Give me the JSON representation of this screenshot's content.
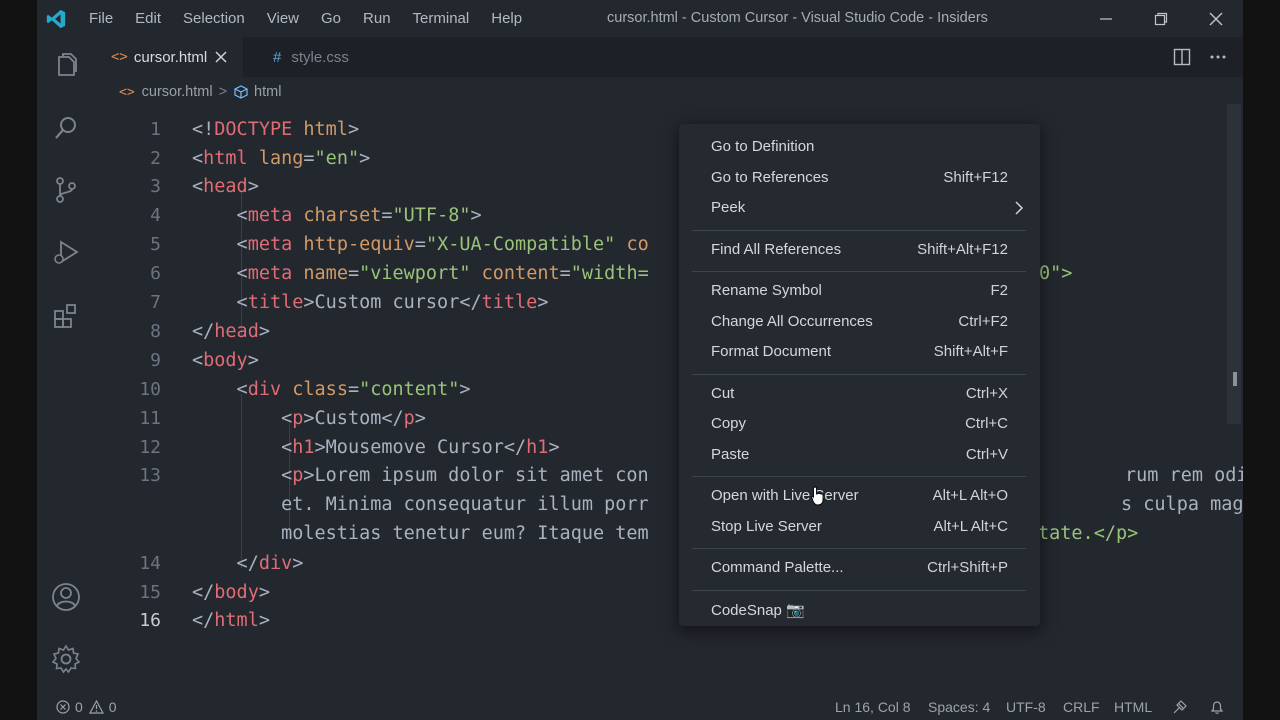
{
  "titlebar": {
    "menu": [
      "File",
      "Edit",
      "Selection",
      "View",
      "Go",
      "Run",
      "Terminal",
      "Help"
    ],
    "title": "cursor.html - Custom Cursor - Visual Studio Code - Insiders"
  },
  "tabs": [
    {
      "icon": "<>",
      "label": "cursor.html"
    },
    {
      "icon": "#",
      "label": "style.css"
    }
  ],
  "breadcrumb": {
    "file": "cursor.html",
    "separator": ">",
    "symbol": "html"
  },
  "editor": {
    "line_numbers": [
      "1",
      "2",
      "3",
      "4",
      "5",
      "6",
      "7",
      "8",
      "9",
      "10",
      "11",
      "12",
      "13",
      "14",
      "15",
      "16"
    ],
    "lines": [
      [
        [
          "x",
          "<!"
        ],
        [
          "t",
          "DOCTYPE"
        ],
        [
          "x",
          " "
        ],
        [
          "a",
          "html"
        ],
        [
          "x",
          ">"
        ]
      ],
      [
        [
          "x",
          "<"
        ],
        [
          "t",
          "html"
        ],
        [
          "x",
          " "
        ],
        [
          "a",
          "lang"
        ],
        [
          "x",
          "="
        ],
        [
          "s",
          "\"en\""
        ],
        [
          "x",
          ">"
        ]
      ],
      [
        [
          "x",
          "<"
        ],
        [
          "t",
          "head"
        ],
        [
          "x",
          ">"
        ]
      ],
      [
        [
          "x",
          "    <"
        ],
        [
          "t",
          "meta"
        ],
        [
          "x",
          " "
        ],
        [
          "a",
          "charset"
        ],
        [
          "x",
          "="
        ],
        [
          "s",
          "\"UTF-8\""
        ],
        [
          "x",
          ">"
        ]
      ],
      [
        [
          "x",
          "    <"
        ],
        [
          "t",
          "meta"
        ],
        [
          "x",
          " "
        ],
        [
          "a",
          "http-equiv"
        ],
        [
          "x",
          "="
        ],
        [
          "s",
          "\"X-UA-Compatible\""
        ],
        [
          "x",
          " "
        ],
        [
          "a",
          "co"
        ]
      ],
      [
        [
          "x",
          "    <"
        ],
        [
          "t",
          "meta"
        ],
        [
          "x",
          " "
        ],
        [
          "a",
          "name"
        ],
        [
          "x",
          "="
        ],
        [
          "s",
          "\"viewport\""
        ],
        [
          "x",
          " "
        ],
        [
          "a",
          "content"
        ],
        [
          "x",
          "="
        ],
        [
          "s",
          "\"width="
        ]
      ],
      [
        [
          "x",
          "    <"
        ],
        [
          "t",
          "title"
        ],
        [
          "x",
          ">Custom cursor</"
        ],
        [
          "t",
          "title"
        ],
        [
          "x",
          ">"
        ]
      ],
      [
        [
          "x",
          "</"
        ],
        [
          "t",
          "head"
        ],
        [
          "x",
          ">"
        ]
      ],
      [
        [
          "x",
          "<"
        ],
        [
          "t",
          "body"
        ],
        [
          "x",
          ">"
        ]
      ],
      [
        [
          "x",
          "    <"
        ],
        [
          "t",
          "div"
        ],
        [
          "x",
          " "
        ],
        [
          "a",
          "class"
        ],
        [
          "x",
          "="
        ],
        [
          "s",
          "\"content\""
        ],
        [
          "x",
          ">"
        ]
      ],
      [
        [
          "x",
          "        <"
        ],
        [
          "t",
          "p"
        ],
        [
          "x",
          ">Custom</"
        ],
        [
          "t",
          "p"
        ],
        [
          "x",
          ">"
        ]
      ],
      [
        [
          "x",
          "        <"
        ],
        [
          "t",
          "h1"
        ],
        [
          "x",
          ">Mousemove Cursor</"
        ],
        [
          "t",
          "h1"
        ],
        [
          "x",
          ">"
        ]
      ],
      [
        [
          "x",
          "        <"
        ],
        [
          "t",
          "p"
        ],
        [
          "x",
          ">Lorem ipsum dolor sit amet con"
        ]
      ],
      [
        [
          "x",
          "        et. Minima consequatur illum porr"
        ]
      ],
      [
        [
          "x",
          "        molestias tenetur eum? Itaque tem"
        ]
      ],
      [
        [
          "x",
          "    </"
        ],
        [
          "t",
          "div"
        ],
        [
          "x",
          ">"
        ]
      ],
      [
        [
          "x",
          "</"
        ],
        [
          "t",
          "body"
        ],
        [
          "x",
          ">"
        ]
      ],
      [
        [
          "x",
          "</"
        ],
        [
          "t",
          "html"
        ],
        [
          "x",
          ">"
        ]
      ]
    ],
    "right_overflow": [
      {
        "text": "0\">",
        "row": 5
      },
      {
        "text": "rum rem odio",
        "row": 12
      },
      {
        "text": "s culpa magni",
        "row": 13
      },
      {
        "text": "tate.</p>",
        "row": 14
      }
    ]
  },
  "context_menu": {
    "groups": [
      [
        {
          "label": "Go to Definition",
          "shortcut": ""
        },
        {
          "label": "Go to References",
          "shortcut": "Shift+F12"
        },
        {
          "label": "Peek",
          "shortcut": "",
          "submenu": true
        }
      ],
      [
        {
          "label": "Find All References",
          "shortcut": "Shift+Alt+F12"
        }
      ],
      [
        {
          "label": "Rename Symbol",
          "shortcut": "F2"
        },
        {
          "label": "Change All Occurrences",
          "shortcut": "Ctrl+F2"
        },
        {
          "label": "Format Document",
          "shortcut": "Shift+Alt+F"
        }
      ],
      [
        {
          "label": "Cut",
          "shortcut": "Ctrl+X"
        },
        {
          "label": "Copy",
          "shortcut": "Ctrl+C"
        },
        {
          "label": "Paste",
          "shortcut": "Ctrl+V"
        }
      ],
      [
        {
          "label": "Open with Live Server",
          "shortcut": "Alt+L Alt+O"
        },
        {
          "label": "Stop Live Server",
          "shortcut": "Alt+L Alt+C"
        }
      ],
      [
        {
          "label": "Command Palette...",
          "shortcut": "Ctrl+Shift+P"
        }
      ],
      [
        {
          "label": "CodeSnap 📷",
          "shortcut": ""
        }
      ]
    ]
  },
  "statusbar": {
    "errors": "0",
    "warnings": "0",
    "position": "Ln 16, Col 8",
    "spaces": "Spaces: 4",
    "encoding": "UTF-8",
    "eol": "CRLF",
    "language": "HTML"
  },
  "colors": {
    "tag": "#e06c75",
    "attr": "#d19a66",
    "string": "#98c379",
    "accent": "#28a8c8"
  }
}
